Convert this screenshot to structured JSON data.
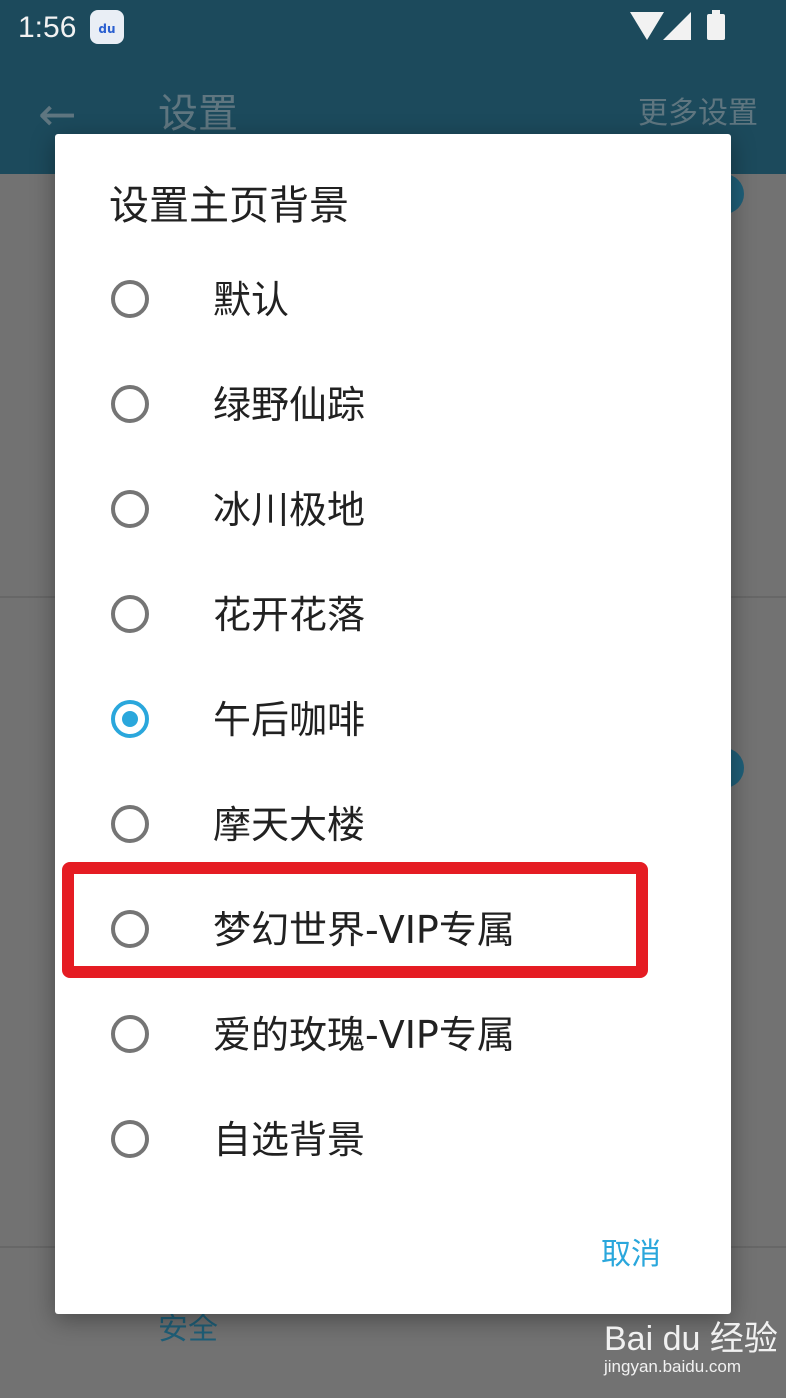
{
  "status_bar": {
    "time": "1:56",
    "app_icon_text": "du"
  },
  "header": {
    "title": "设置",
    "more_settings": "更多设置"
  },
  "background": {
    "security_label": "安全"
  },
  "dialog": {
    "title": "设置主页背景",
    "options": [
      {
        "label": "默认",
        "checked": false
      },
      {
        "label": "绿野仙踪",
        "checked": false
      },
      {
        "label": "冰川极地",
        "checked": false
      },
      {
        "label": "花开花落",
        "checked": false
      },
      {
        "label": "午后咖啡",
        "checked": true
      },
      {
        "label": "摩天大楼",
        "checked": false
      },
      {
        "label": "梦幻世界-VIP专属",
        "checked": false
      },
      {
        "label": "爱的玫瑰-VIP专属",
        "checked": false
      },
      {
        "label": "自选背景",
        "checked": false
      }
    ],
    "cancel_label": "取消"
  },
  "watermark": {
    "logo_text": "Bai du 经验",
    "url": "jingyan.baidu.com"
  },
  "colors": {
    "header": "#1c4a5c",
    "accent": "#2aa7dc",
    "highlight": "#e51c23"
  }
}
